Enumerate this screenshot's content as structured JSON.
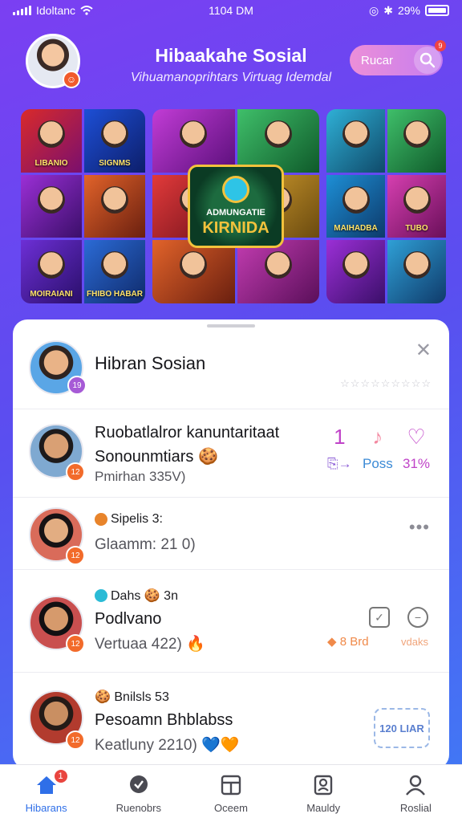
{
  "status": {
    "carrier": "Idoltanc",
    "time": "1104 DM",
    "battery": "29%"
  },
  "header": {
    "title": "Hibaakahe Sosial",
    "subtitle": "Vihuamanoprihtars Virtuag Idemdal",
    "search_label": "Rucar",
    "profile_badge": "☺",
    "search_notification": "9"
  },
  "banners": {
    "left": [
      "LIBANIO",
      "SIGNMS",
      "",
      "",
      "MOIRAIANI",
      "FHIBO HABAR"
    ],
    "center": [
      "",
      "",
      "",
      "",
      "",
      ""
    ],
    "center_overlay": {
      "top": "ADMUNGATIE",
      "main": "KIRNIDA"
    },
    "right": [
      "",
      "",
      "MAIHADBA",
      "TUBO",
      "",
      ""
    ]
  },
  "sheet": {
    "header_item": {
      "name": "Hibran Sosian",
      "badge": "19",
      "stars": "☆☆☆☆☆☆☆☆☆"
    },
    "items": [
      {
        "line1": "Ruobatlalror kanuntaritaat",
        "line2": "Sonounmtiars 🍪",
        "line3": "Pmirhan 335V)",
        "badge": "12",
        "actions": [
          {
            "icon": "1",
            "label": "⎘→"
          },
          {
            "icon": "♪",
            "label": "Poss"
          },
          {
            "icon": "♡",
            "label": "31%"
          }
        ]
      },
      {
        "tag": "Sipelis 3:",
        "line2": "Glaamm: 21 0)",
        "badge": "12"
      },
      {
        "tag": "Dahs 🍪 3n",
        "line2": "Podlvano",
        "line3": "Vertuaa 422) 🔥",
        "badge": "12",
        "side_label_1": "8 Brd",
        "side_label_2": "vdaks"
      },
      {
        "tag": "🍪 Bnilsls 53",
        "line2": "Pesoamn Bhblabss",
        "line3": "Keatluny 2210) 💙🧡",
        "badge": "12",
        "sticker": "120 LIAR"
      }
    ]
  },
  "tabs": [
    {
      "label": "Hibarans",
      "badge": "1",
      "active": true
    },
    {
      "label": "Ruenobrs"
    },
    {
      "label": "Oceem"
    },
    {
      "label": "Mauldy"
    },
    {
      "label": "Roslial"
    }
  ],
  "colors": {
    "background_start": "#7b3ff2",
    "background_end": "#3f7bf5",
    "accent_orange": "#f26b2b",
    "accent_pink": "#c043c8",
    "active_tab": "#2f6fe8"
  }
}
